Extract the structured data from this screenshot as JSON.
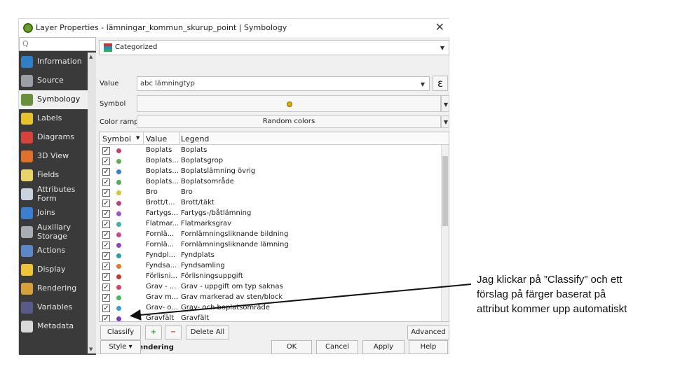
{
  "window": {
    "title": "Layer Properties - lämningar_kommun_skurup_point | Symbology",
    "close_icon": "close-icon"
  },
  "sidebar": {
    "search_glyph": "Q",
    "items": [
      {
        "label": "Information",
        "icon": "information-icon",
        "color": "#2f7fc8"
      },
      {
        "label": "Source",
        "icon": "source-icon",
        "color": "#9aa0a6"
      },
      {
        "label": "Symbology",
        "icon": "symbology-icon",
        "color": "#6a8f3a"
      },
      {
        "label": "Labels",
        "icon": "labels-icon",
        "color": "#e6c32b"
      },
      {
        "label": "Diagrams",
        "icon": "diagrams-icon",
        "color": "#d9413b"
      },
      {
        "label": "3D View",
        "icon": "3d-view-icon",
        "color": "#e0702a"
      },
      {
        "label": "Fields",
        "icon": "fields-icon",
        "color": "#e9d36b"
      },
      {
        "label": "Attributes Form",
        "icon": "attributes-form-icon",
        "color": "#c9d3df"
      },
      {
        "label": "Joins",
        "icon": "joins-icon",
        "color": "#3b7fd0"
      },
      {
        "label": "Auxiliary Storage",
        "icon": "auxiliary-storage-icon",
        "color": "#a8adb3"
      },
      {
        "label": "Actions",
        "icon": "actions-icon",
        "color": "#5b88c8"
      },
      {
        "label": "Display",
        "icon": "display-icon",
        "color": "#f0c43a"
      },
      {
        "label": "Rendering",
        "icon": "rendering-icon",
        "color": "#d6a13a"
      },
      {
        "label": "Variables",
        "icon": "variables-icon",
        "color": "#5a5a8a"
      },
      {
        "label": "Metadata",
        "icon": "metadata-icon",
        "color": "#d9d9d9"
      }
    ]
  },
  "symbology": {
    "renderer": "Categorized",
    "value_label": "Value",
    "value_field": "abc lämningtyp",
    "epsilon_glyph": "ε",
    "symbol_label": "Symbol",
    "ramp_label": "Color ramp",
    "ramp_value": "Random colors",
    "table": {
      "headers": [
        "Symbol",
        "Value",
        "Legend"
      ],
      "rows": [
        {
          "value": "Boplats",
          "legend": "Boplats",
          "color": "#c0456e"
        },
        {
          "value": "Boplats...",
          "legend": "Boplatsgrop",
          "color": "#5fae4a"
        },
        {
          "value": "Boplats...",
          "legend": "Boplatslämning övrig",
          "color": "#3a7bc8"
        },
        {
          "value": "Boplats...",
          "legend": "Boplatsområde",
          "color": "#4caf50"
        },
        {
          "value": "Bro",
          "legend": "Bro",
          "color": "#d4c43a"
        },
        {
          "value": "Brott/t...",
          "legend": "Brott/täkt",
          "color": "#b5427a"
        },
        {
          "value": "Fartygs...",
          "legend": "Fartygs-/båtlämning",
          "color": "#9a55c9"
        },
        {
          "value": "Flatmar...",
          "legend": "Flatmarksgrav",
          "color": "#3fb0a8"
        },
        {
          "value": "Fornlä...",
          "legend": "Fornlämningsliknande bildning",
          "color": "#c24a8a"
        },
        {
          "value": "Fornlä...",
          "legend": "Fornlämningsliknande lämning",
          "color": "#8e44d0"
        },
        {
          "value": "Fyndpl...",
          "legend": "Fyndplats",
          "color": "#2e9aa8"
        },
        {
          "value": "Fyndsa...",
          "legend": "Fyndsamling",
          "color": "#e07a2a"
        },
        {
          "value": "Förlisni...",
          "legend": "Förlisningsuppgift",
          "color": "#c0392b"
        },
        {
          "value": "Grav - ...",
          "legend": "Grav - uppgift om typ saknas",
          "color": "#d1456a"
        },
        {
          "value": "Grav m...",
          "legend": "Grav markerad av sten/block",
          "color": "#48b860"
        },
        {
          "value": "Grav- o...",
          "legend": "Grav- och boplatsområde",
          "color": "#3a9ad0"
        },
        {
          "value": "Gravfält",
          "legend": "Gravfält",
          "color": "#7a3ab8"
        }
      ]
    },
    "buttons": {
      "classify": "Classify",
      "add_icon": "add-icon",
      "remove_icon": "remove-icon",
      "delete_all": "Delete All",
      "advanced": "Advanced"
    },
    "layer_rendering": "Layer Rendering"
  },
  "footer": {
    "style": "Style",
    "ok": "OK",
    "cancel": "Cancel",
    "apply": "Apply",
    "help": "Help"
  },
  "annotation": "Jag klickar på ”Classify” och ett förslag på färger baserat på attribut kommer upp automatiskt"
}
